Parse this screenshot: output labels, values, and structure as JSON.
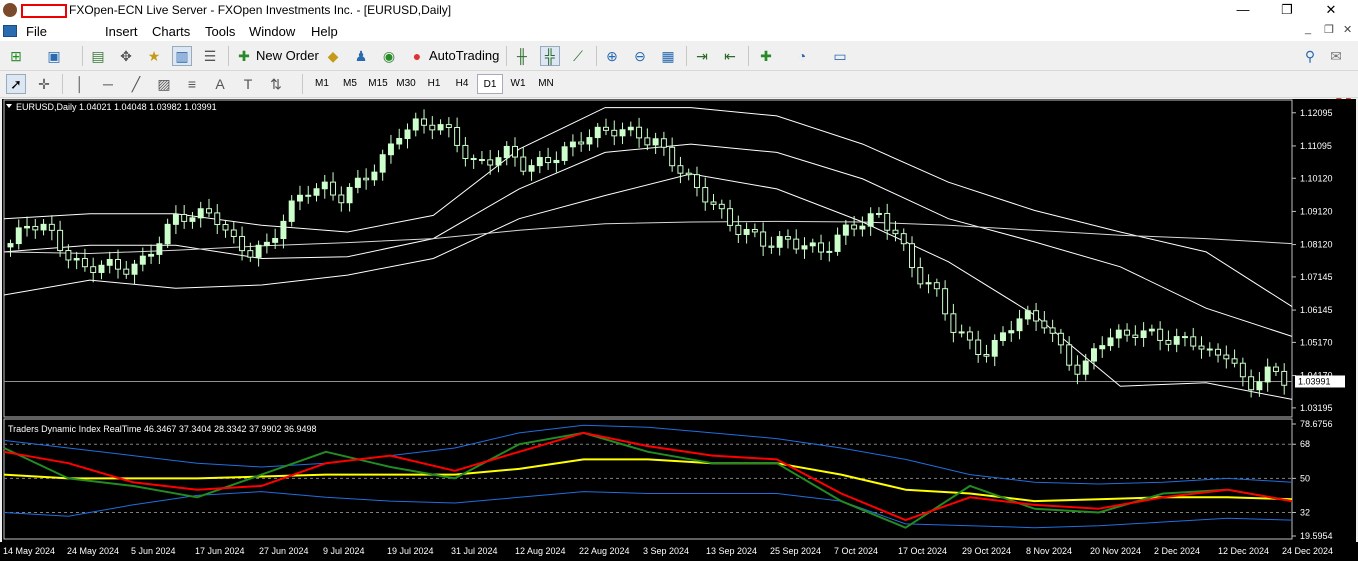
{
  "window": {
    "title": "FXOpen-ECN Live Server - FXOpen Investments Inc. - [EURUSD,Daily]",
    "minimize": "—",
    "maximize": "❐",
    "close": "✕"
  },
  "menu": {
    "items": [
      "File",
      "Insert",
      "Charts",
      "Tools",
      "Window",
      "Help"
    ],
    "mdi_minimize": "_",
    "mdi_restore": "❐",
    "mdi_close": "✕"
  },
  "toolbar": {
    "new_order": "New Order",
    "autotrading": "AutoTrading",
    "notifications_count": "1"
  },
  "timeframes": [
    "M1",
    "M5",
    "M15",
    "M30",
    "H1",
    "H4",
    "D1",
    "W1",
    "MN"
  ],
  "active_timeframe": "D1",
  "colors": {
    "background": "#000000",
    "bull_candle": "#ccffcc",
    "bear_candle": "#000000",
    "candle_outline": "#ccffcc",
    "bands": "#ffffff",
    "tdi_red": "#ff0000",
    "tdi_green": "#228b22",
    "tdi_yellow": "#ffff00",
    "tdi_blue": "#1e6fe0"
  },
  "chart": {
    "info": "EURUSD,Daily  1.04021 1.04048 1.03982 1.03991",
    "price_labels": [
      "1.12095",
      "1.11095",
      "1.10120",
      "1.09120",
      "1.08120",
      "1.07145",
      "1.06145",
      "1.05170",
      "1.04170",
      "1.03195"
    ],
    "current_price": "1.03991",
    "indicator_info": "Traders Dynamic Index RealTime 46.3467 37.3404 28.3342 37.9902 36.9498",
    "indicator_levels": [
      "78.6756",
      "68",
      "50",
      "32",
      "19.5954"
    ]
  },
  "chart_data": {
    "type": "candlestick",
    "symbol": "EURUSD",
    "timeframe": "Daily",
    "x_labels": [
      "14 May 2024",
      "24 May 2024",
      "5 Jun 2024",
      "17 Jun 2024",
      "27 Jun 2024",
      "9 Jul 2024",
      "19 Jul 2024",
      "31 Jul 2024",
      "12 Aug 2024",
      "22 Aug 2024",
      "3 Sep 2024",
      "13 Sep 2024",
      "25 Sep 2024",
      "7 Oct 2024",
      "17 Oct 2024",
      "29 Oct 2024",
      "8 Nov 2024",
      "20 Nov 2024",
      "2 Dec 2024",
      "12 Dec 2024",
      "24 Dec 2024"
    ],
    "ylim": [
      1.0295,
      1.1245
    ],
    "close_anchors": [
      [
        1.0815,
        1.0865,
        1.0855,
        1.0795,
        1.0745,
        1.0745,
        1.0725,
        1.0755,
        1.0835,
        1.0895,
        1.0885,
        1.0905,
        1.0835,
        1.0795
      ],
      [
        1.08,
        1.09,
        1.0985,
        1.0995,
        1.095,
        1.0995,
        1.105,
        1.116,
        1.118,
        1.1165,
        1.113,
        1.106,
        1.108,
        1.109
      ],
      [
        1.1025,
        1.1065,
        1.1105,
        1.114,
        1.114,
        1.115,
        1.115,
        1.113,
        1.105,
        1.0975,
        1.094,
        1.0885,
        1.085,
        1.08
      ],
      [
        1.0815,
        1.082,
        1.08,
        1.084,
        1.0865,
        1.09,
        1.086,
        1.0725,
        1.067,
        1.056,
        1.052,
        1.049,
        1.0555,
        1.0585
      ],
      [
        1.058,
        1.05,
        1.042,
        1.051,
        1.053,
        1.056,
        1.055,
        1.051,
        1.0515,
        1.048,
        1.05,
        1.037,
        1.042,
        1.0399
      ]
    ],
    "bollinger": {
      "upper": [
        1.089,
        1.0905,
        1.0905,
        1.087,
        1.085,
        1.09,
        1.11,
        1.1225,
        1.1225,
        1.12,
        1.1115,
        1.1,
        1.0915,
        1.085,
        1.079,
        1.0625
      ],
      "middle": [
        1.079,
        1.081,
        1.081,
        1.077,
        1.0775,
        1.083,
        1.098,
        1.109,
        1.1115,
        1.109,
        1.101,
        1.089,
        1.082,
        1.0745,
        1.062,
        1.0535
      ],
      "lower": [
        1.066,
        1.0705,
        1.068,
        1.069,
        1.072,
        1.077,
        1.089,
        1.096,
        1.1025,
        1.098,
        1.088,
        1.076,
        1.06,
        1.0385,
        1.0395,
        1.0345
      ],
      "long_ma": [
        1.079,
        1.0785,
        1.0795,
        1.0808,
        1.0818,
        1.083,
        1.0855,
        1.0875,
        1.088,
        1.0882,
        1.088,
        1.087,
        1.0855,
        1.084,
        1.083,
        1.0815
      ]
    },
    "tdi": {
      "ylim": [
        19.5954,
        78.6756
      ],
      "levels": [
        68,
        50,
        32
      ],
      "upper_band": [
        70,
        66,
        62,
        58,
        56,
        58,
        62,
        66,
        74,
        78,
        77,
        74,
        71,
        66,
        60,
        52,
        48,
        47,
        48,
        50,
        48
      ],
      "lower_band": [
        32,
        30,
        36,
        41,
        43,
        40,
        38,
        37,
        40,
        43,
        42,
        42,
        42,
        38,
        26,
        25,
        24,
        25,
        27,
        29,
        28
      ],
      "middle": [
        52,
        50,
        50,
        50,
        51,
        52,
        52,
        52,
        55,
        60,
        60,
        58,
        58,
        52,
        44,
        42,
        38,
        39,
        40,
        40,
        39
      ],
      "red": [
        64,
        58,
        48,
        44,
        46,
        58,
        62,
        54,
        64,
        74,
        67,
        62,
        60,
        42,
        28,
        40,
        36,
        34,
        40,
        44,
        38
      ],
      "green": [
        66,
        50,
        46,
        40,
        52,
        64,
        56,
        50,
        68,
        74,
        64,
        58,
        58,
        38,
        24,
        46,
        34,
        32,
        42,
        44,
        38
      ]
    }
  }
}
